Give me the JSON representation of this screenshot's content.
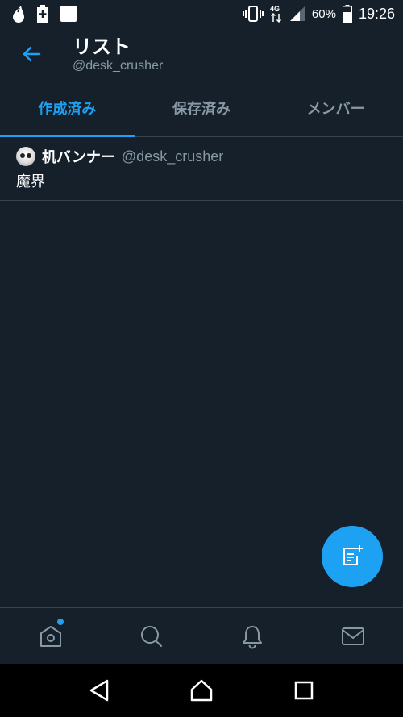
{
  "status_bar": {
    "battery_percent": "60%",
    "time": "19:26",
    "network": "4G",
    "icons": [
      "drop-icon",
      "battery-saver-icon",
      "notification-square-icon",
      "vibrate-icon",
      "signal-icon",
      "battery-icon"
    ]
  },
  "header": {
    "title": "リスト",
    "subtitle": "@desk_crusher"
  },
  "tabs": [
    {
      "label": "作成済み",
      "active": true
    },
    {
      "label": "保存済み",
      "active": false
    },
    {
      "label": "メンバー",
      "active": false
    }
  ],
  "lists": [
    {
      "name": "机バンナー",
      "owner": "@desk_crusher",
      "description": "魔界"
    }
  ],
  "bottom_nav": [
    "home-icon",
    "search-icon",
    "notifications-icon",
    "messages-icon"
  ],
  "colors": {
    "background": "#15202b",
    "accent": "#1da1f2",
    "muted": "#8899a6",
    "divider": "#38444d"
  }
}
